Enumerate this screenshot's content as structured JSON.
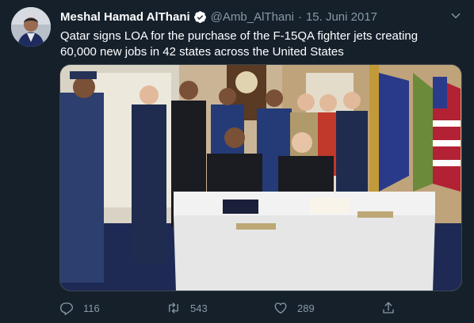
{
  "tweet": {
    "author_name": "Meshal Hamad AlThani",
    "handle": "@Amb_AlThani",
    "separator": "·",
    "date": "15. Juni 2017",
    "text": "Qatar signs LOA for the purchase of the F-15QA fighter jets creating 60,000 new jobs in 42 states across the United States"
  },
  "actions": {
    "reply_count": "116",
    "retweet_count": "543",
    "like_count": "289"
  },
  "icons": {
    "verified": "verified-badge-icon",
    "more": "chevron-down-icon",
    "reply": "reply-icon",
    "retweet": "retweet-icon",
    "like": "heart-icon",
    "share": "share-icon"
  },
  "colors": {
    "background": "#15202b",
    "secondary_text": "#8899a6",
    "verified": "#ffffff",
    "border": "#38444d"
  }
}
